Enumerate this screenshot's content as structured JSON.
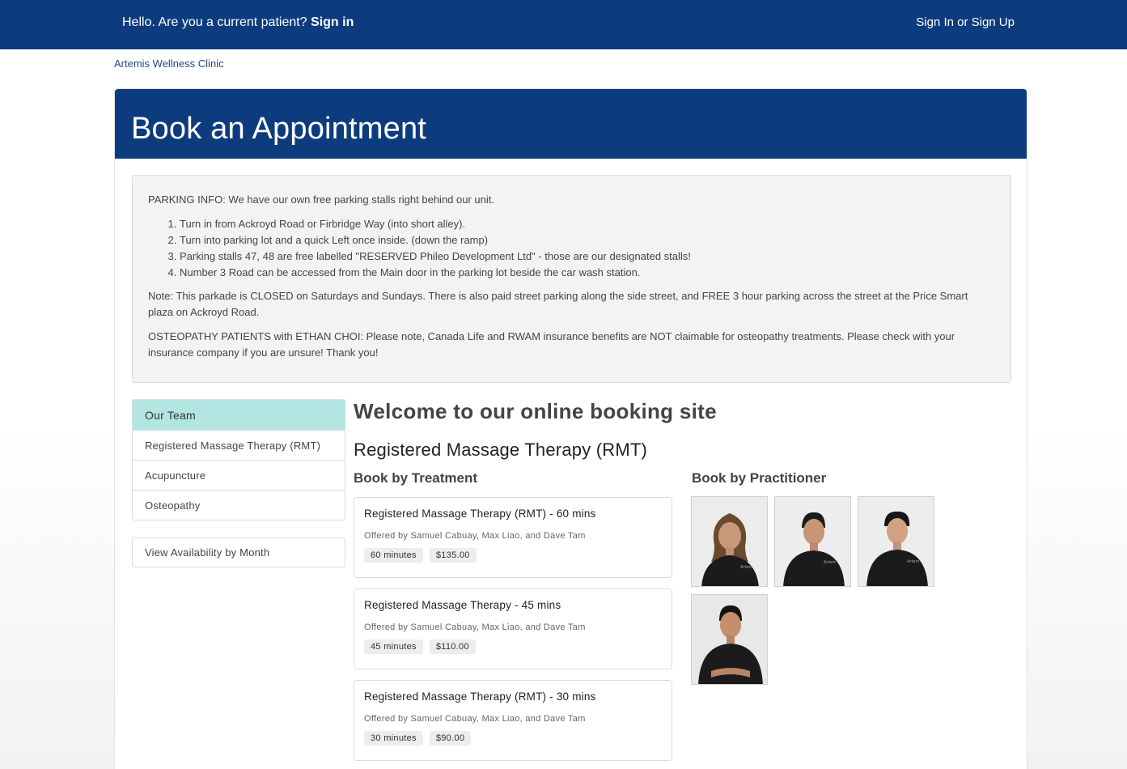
{
  "topbar": {
    "greeting": "Hello. Are you a current patient?",
    "sign_in": "Sign in",
    "signup": "Sign In or Sign Up"
  },
  "breadcrumb": "Artemis Wellness Clinic",
  "header": {
    "title": "Book an Appointment"
  },
  "notice": {
    "intro": "PARKING INFO: We have our own free parking stalls right behind our unit.",
    "steps": [
      "Turn in from Ackroyd Road or Firbridge Way (into short alley).",
      "Turn into parking lot and a quick Left once inside. (down the ramp)",
      "Parking stalls 47, 48 are free labelled \"RESERVED Phileo Development Ltd\" - those are our designated stalls!",
      "Number 3 Road can be accessed from the Main door in the parking lot beside the car wash station."
    ],
    "note": "Note: This parkade is CLOSED on Saturdays and Sundays. There is also paid street parking along the side street, and FREE 3 hour parking across the street at the Price Smart plaza on Ackroyd Road.",
    "osteo": "OSTEOPATHY PATIENTS with ETHAN CHOI: Please note, Canada Life and RWAM insurance benefits are NOT claimable for osteopathy treatments. Please check with your insurance company if you are unsure! Thank you!"
  },
  "sidebar": {
    "items": [
      {
        "label": "Our Team"
      },
      {
        "label": "Registered Massage Therapy (RMT)"
      },
      {
        "label": "Acupuncture"
      },
      {
        "label": "Osteopathy"
      }
    ],
    "availability": "View Availability by Month"
  },
  "main": {
    "welcome": "Welcome to our online booking site",
    "section": "Registered Massage Therapy (RMT)",
    "by_treatment": "Book by Treatment",
    "by_practitioner": "Book by Practitioner",
    "treatments": [
      {
        "name": "Registered Massage Therapy (RMT) - 60 mins",
        "offered": "Offered by Samuel Cabuay, Max Liao, and Dave Tam",
        "duration": "60 minutes",
        "price": "$135.00"
      },
      {
        "name": "Registered Massage Therapy - 45 mins",
        "offered": "Offered by Samuel Cabuay, Max Liao, and Dave Tam",
        "duration": "45 minutes",
        "price": "$110.00"
      },
      {
        "name": "Registered Massage Therapy (RMT) - 30 mins",
        "offered": "Offered by Samuel Cabuay, Max Liao, and Dave Tam",
        "duration": "30 minutes",
        "price": "$90.00"
      }
    ]
  },
  "colors": {
    "brand": "#0d3c7e",
    "active_tab": "#b3e5e3"
  }
}
